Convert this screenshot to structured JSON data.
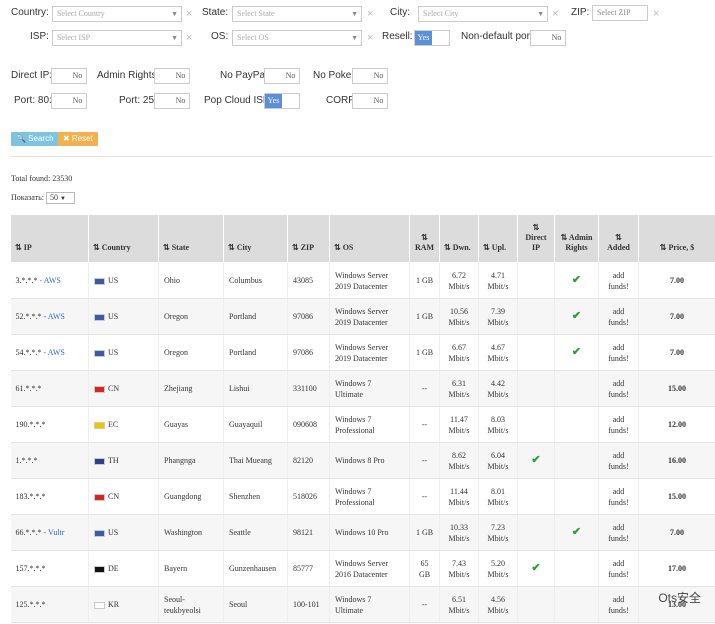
{
  "filters": {
    "country": {
      "label": "Country:",
      "placeholder": "Select Country"
    },
    "state": {
      "label": "State:",
      "placeholder": "Select State"
    },
    "city": {
      "label": "City:",
      "placeholder": "Select City"
    },
    "zip": {
      "label": "ZIP:",
      "placeholder": "Select ZIP"
    },
    "isp": {
      "label": "ISP:",
      "placeholder": "Select ISP"
    },
    "os": {
      "label": "OS:",
      "placeholder": "Select OS"
    },
    "resell": {
      "label": "Resell:",
      "value": "Yes"
    },
    "non_default_port": {
      "label": "Non-default port",
      "value": "No"
    },
    "direct_ip": {
      "label": "Direct IP:",
      "value": "No"
    },
    "admin_rights": {
      "label": "Admin Rights:",
      "value": "No"
    },
    "no_paypal": {
      "label": "No PayPal:",
      "value": "No"
    },
    "no_poker": {
      "label": "No Poker:",
      "value": "No"
    },
    "port80": {
      "label": "Port: 80:",
      "value": "No"
    },
    "port25": {
      "label": "Port: 25:",
      "value": "No"
    },
    "pop_cloud_isp": {
      "label": "Pop Cloud ISP:",
      "value": "Yes"
    },
    "corp": {
      "label": "CORP:",
      "value": "No"
    },
    "clear_icon": "×"
  },
  "buttons": {
    "search": "🔍 Search",
    "reset": "✖ Reset"
  },
  "summary": {
    "total_found": "Total found: 23530",
    "per_page_label": "Показать:",
    "per_page_value": "50"
  },
  "table": {
    "headers": {
      "ip": "⇅ IP",
      "country": "⇅ Country",
      "state": "⇅ State",
      "city": "⇅ City",
      "zip": "⇅ ZIP",
      "os": "⇅ OS",
      "ram_a": "⇅",
      "ram_b": "RAM",
      "dwn": "⇅ Dwn.",
      "upl": "⇅ Upl.",
      "direct_a": "⇅",
      "direct_b": "Direct",
      "direct_c": "IP",
      "admin_a": "⇅ Admin",
      "admin_b": "Rights",
      "added_a": "⇅",
      "added_b": "Added",
      "price": "⇅ Price, $"
    },
    "rows": [
      {
        "ip": "3.*.*.*",
        "tag": " - AWS",
        "cc": "US",
        "state": "Ohio",
        "city": "Columbus",
        "zip": "43085",
        "os1": "Windows Server",
        "os2": "2019 Datacenter",
        "ram1": "1 GB",
        "ram2": "",
        "dwn1": "6.72",
        "dwn2": "Mbit/s",
        "upl1": "4.71",
        "upl2": "Mbit/s",
        "direct": "",
        "admin": "✔",
        "add1": "add",
        "add2": "funds!",
        "price": "7.00"
      },
      {
        "ip": "52.*.*.*",
        "tag": " - AWS",
        "cc": "US",
        "state": "Oregon",
        "city": "Portland",
        "zip": "97086",
        "os1": "Windows Server",
        "os2": "2019 Datacenter",
        "ram1": "1 GB",
        "ram2": "",
        "dwn1": "10.56",
        "dwn2": "Mbit/s",
        "upl1": "7.39",
        "upl2": "Mbit/s",
        "direct": "",
        "admin": "✔",
        "add1": "add",
        "add2": "funds!",
        "price": "7.00"
      },
      {
        "ip": "54.*.*.*",
        "tag": " - AWS",
        "cc": "US",
        "state": "Oregon",
        "city": "Portland",
        "zip": "97086",
        "os1": "Windows Server",
        "os2": "2019 Datacenter",
        "ram1": "1 GB",
        "ram2": "",
        "dwn1": "6.67",
        "dwn2": "Mbit/s",
        "upl1": "4.67",
        "upl2": "Mbit/s",
        "direct": "",
        "admin": "✔",
        "add1": "add",
        "add2": "funds!",
        "price": "7.00"
      },
      {
        "ip": "61.*.*.*",
        "tag": "",
        "cc": "CN",
        "state": "Zhejiang",
        "city": "Lishui",
        "zip": "331100",
        "os1": "Windows 7",
        "os2": "Ultimate",
        "ram1": "--",
        "ram2": "",
        "dwn1": "6.31",
        "dwn2": "Mbit/s",
        "upl1": "4.42",
        "upl2": "Mbit/s",
        "direct": "",
        "admin": "",
        "add1": "add",
        "add2": "funds!",
        "price": "15.00"
      },
      {
        "ip": "190.*.*.*",
        "tag": "",
        "cc": "EC",
        "state": "Guayas",
        "city": "Guayaquil",
        "zip": "090608",
        "os1": "Windows 7",
        "os2": "Professional",
        "ram1": "--",
        "ram2": "",
        "dwn1": "11.47",
        "dwn2": "Mbit/s",
        "upl1": "8.03",
        "upl2": "Mbit/s",
        "direct": "",
        "admin": "",
        "add1": "add",
        "add2": "funds!",
        "price": "12.00"
      },
      {
        "ip": "1.*.*.*",
        "tag": "",
        "cc": "TH",
        "state": "Phangnga",
        "city": "Thai Mueang",
        "zip": "82120",
        "os1": "Windows 8 Pro",
        "os2": "",
        "ram1": "--",
        "ram2": "",
        "dwn1": "8.62",
        "dwn2": "Mbit/s",
        "upl1": "6.04",
        "upl2": "Mbit/s",
        "direct": "✔",
        "admin": "",
        "add1": "add",
        "add2": "funds!",
        "price": "16.00"
      },
      {
        "ip": "183.*.*.*",
        "tag": "",
        "cc": "CN",
        "state": "Guangdong",
        "city": "Shenzhen",
        "zip": "518026",
        "os1": "Windows 7",
        "os2": "Professional",
        "ram1": "--",
        "ram2": "",
        "dwn1": "11.44",
        "dwn2": "Mbit/s",
        "upl1": "8.01",
        "upl2": "Mbit/s",
        "direct": "",
        "admin": "",
        "add1": "add",
        "add2": "funds!",
        "price": "15.00"
      },
      {
        "ip": "66.*.*.*",
        "tag": " - Vultr",
        "cc": "US",
        "state": "Washington",
        "city": "Seattle",
        "zip": "98121",
        "os1": "Windows 10 Pro",
        "os2": "",
        "ram1": "1 GB",
        "ram2": "",
        "dwn1": "10.33",
        "dwn2": "Mbit/s",
        "upl1": "7.23",
        "upl2": "Mbit/s",
        "direct": "",
        "admin": "✔",
        "add1": "add",
        "add2": "funds!",
        "price": "7.00"
      },
      {
        "ip": "157.*.*.*",
        "tag": "",
        "cc": "DE",
        "state": "Bayern",
        "city": "Gunzenhausen",
        "zip": "85777",
        "os1": "Windows Server",
        "os2": "2016 Datacenter",
        "ram1": "65",
        "ram2": "GB",
        "dwn1": "7.43",
        "dwn2": "Mbit/s",
        "upl1": "5.20",
        "upl2": "Mbit/s",
        "direct": "✔",
        "admin": "",
        "add1": "add",
        "add2": "funds!",
        "price": "17.00"
      },
      {
        "ip": "125.*.*.*",
        "tag": "",
        "cc": "KR",
        "state": "Seoul-",
        "state2": "teukbyeolsi",
        "city": "Seoul",
        "zip": "100-101",
        "os1": "Windows 7",
        "os2": "Ultimate",
        "ram1": "--",
        "ram2": "",
        "dwn1": "6.51",
        "dwn2": "Mbit/s",
        "upl1": "4.56",
        "upl2": "Mbit/s",
        "direct": "",
        "admin": "",
        "add1": "add",
        "add2": "funds!",
        "price": "13.00"
      }
    ]
  },
  "flags": {
    "US": "#3c5aa6",
    "CN": "#d8261f",
    "EC": "#f2c500",
    "TH": "#2d3f8c",
    "DE": "#111111",
    "KR": "#ffffff"
  },
  "watermark": "Ots安全"
}
